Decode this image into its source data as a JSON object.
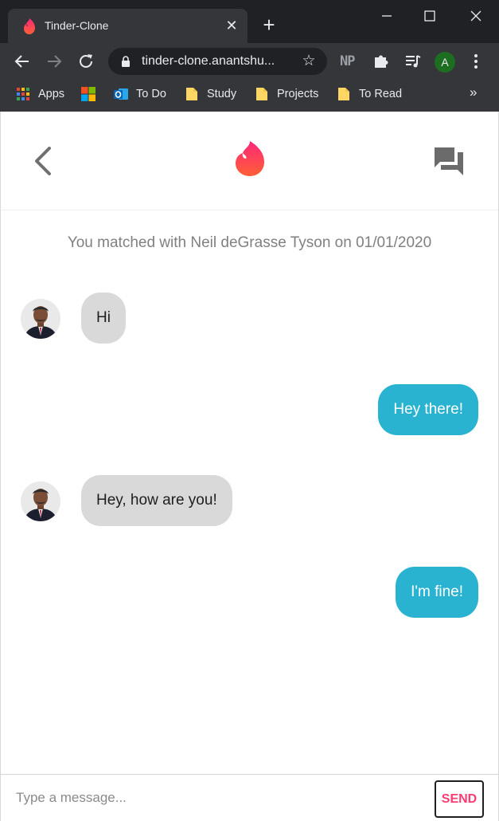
{
  "browser": {
    "tab_title": "Tinder-Clone",
    "url": "tinder-clone.anantshu...",
    "extension_np": "NP",
    "profile_initial": "A",
    "bookmarks": [
      {
        "label": "Apps",
        "icon": "apps-grid-icon"
      },
      {
        "label": "",
        "icon": "microsoft-logo-icon"
      },
      {
        "label": "To Do",
        "icon": "outlook-icon"
      },
      {
        "label": "Study",
        "icon": "folder-icon"
      },
      {
        "label": "Projects",
        "icon": "folder-icon"
      },
      {
        "label": "To Read",
        "icon": "folder-icon"
      }
    ],
    "more_bookmarks": "»"
  },
  "header": {
    "back_icon": "chevron-left-icon",
    "logo_icon": "tinder-flame-icon",
    "chat_icon": "chat-bubbles-icon"
  },
  "chat": {
    "match_text": "You matched with Neil deGrasse Tyson on 01/01/2020",
    "messages": [
      {
        "from": "them",
        "text": "Hi"
      },
      {
        "from": "me",
        "text": "Hey there!"
      },
      {
        "from": "them",
        "text": "Hey, how are you!"
      },
      {
        "from": "me",
        "text": "I'm fine!"
      }
    ]
  },
  "composer": {
    "placeholder": "Type a message...",
    "value": "",
    "send_label": "SEND"
  },
  "colors": {
    "brand": "#fe3c72",
    "bubble_me": "#29b3d1",
    "bubble_them": "#d9d9d9"
  }
}
